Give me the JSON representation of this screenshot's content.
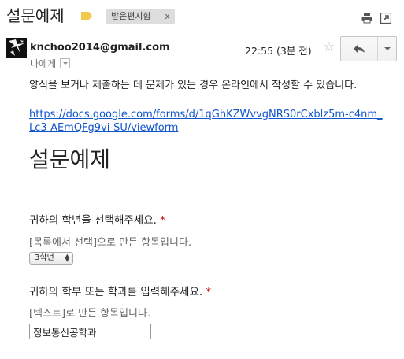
{
  "header": {
    "subject": "설문예제",
    "label_chip": "받은편지함",
    "label_close": "x",
    "icons": [
      "label-icon",
      "print-icon",
      "new-window-icon"
    ]
  },
  "message": {
    "sender": "knchoo2014@gmail.com",
    "to": "나에게",
    "time": "22:55 (3분 전)",
    "star": "☆",
    "actions": [
      "reply-icon",
      "more-dropdown-icon"
    ],
    "body": "양식을 보거나 제출하는 데 문제가 있는 경우 온라인에서 작성할 수 있습니다.",
    "link": "https://docs.google.com/forms/d/1qGhKZWvvgNRS0rCxblz5m-c4nm_Lc3-AEmQFg9vi-SU/viewform"
  },
  "form": {
    "title": "설문예제",
    "q1": {
      "label": "귀하의 학년을 선택해주세요.",
      "required": "*",
      "help": "[목록에서 선택]으로 만든 항목입니다.",
      "selected": "3학년"
    },
    "q2": {
      "label": "귀하의 학부 또는 학과를 입력해주세요.",
      "required": "*",
      "help": "[텍스트]로 만든 항목입니다.",
      "value": "정보통신공학과"
    }
  },
  "colors": {
    "link": "#1155cc",
    "required": "#cc0000",
    "label_icon": "#f2c94c",
    "chip_bg": "#dddddd"
  }
}
